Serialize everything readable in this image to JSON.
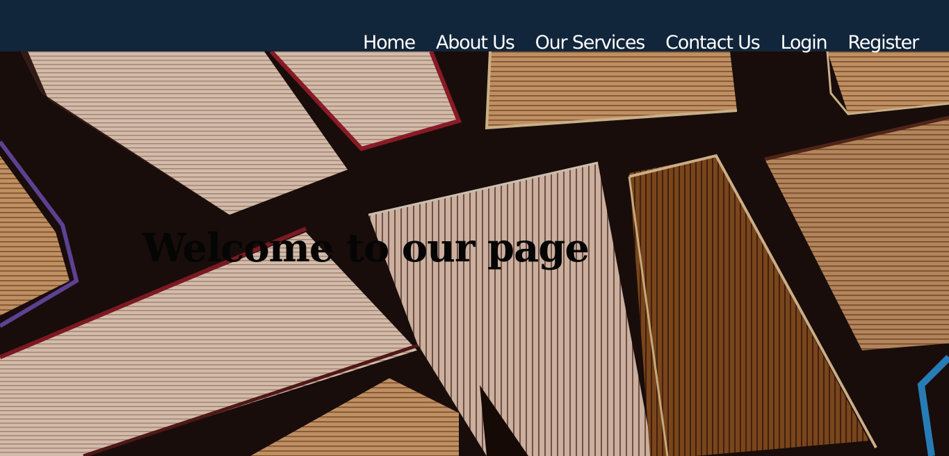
{
  "nav": {
    "items": [
      {
        "label": "Home"
      },
      {
        "label": "About Us"
      },
      {
        "label": "Our Services"
      },
      {
        "label": "Contact Us"
      },
      {
        "label": "Login"
      },
      {
        "label": "Register"
      }
    ]
  },
  "hero": {
    "title": "Welcome to our page",
    "background": "books-photo"
  },
  "colors": {
    "navbar": "#11253b",
    "nav_text": "#ffffff",
    "title": "#050505"
  }
}
